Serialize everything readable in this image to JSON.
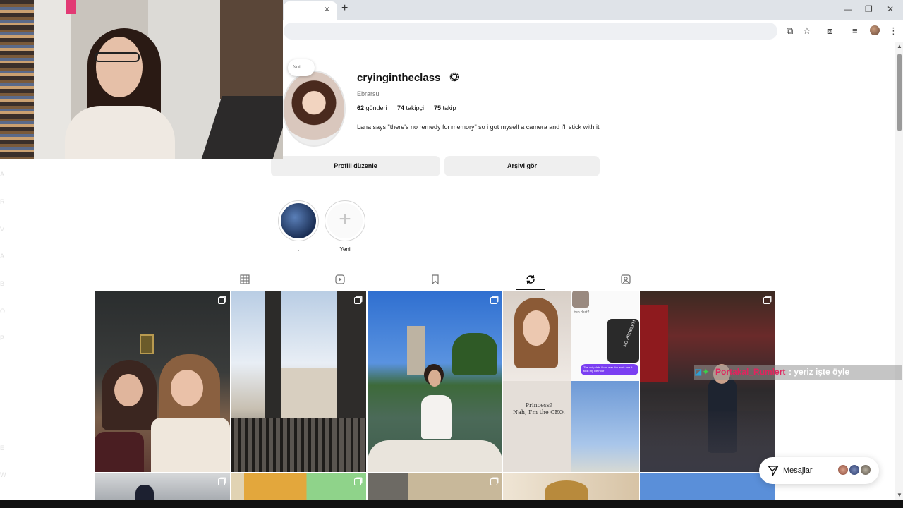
{
  "browser": {
    "tab_close": "×",
    "new_tab": "+",
    "minimize": "—",
    "restore": "❐",
    "close": "✕"
  },
  "profile": {
    "note": "Not...",
    "username": "cryinginthe­class",
    "full_name": "Ebrarsu",
    "stats": {
      "posts_count": "62",
      "posts_label": "gönderi",
      "followers_count": "74",
      "followers_label": "takipçi",
      "following_count": "75",
      "following_label": "takip"
    },
    "bio": "Lana says \"there's no remedy for memory\" so i got myself a camera and i'll stick with it",
    "buttons": {
      "edit_profile": "Profili düzenle",
      "view_archive": "Arşivi gör"
    }
  },
  "highlights": [
    {
      "label": "."
    },
    {
      "label": "Yeni",
      "plus": "+"
    }
  ],
  "tabs": [
    "posts-grid",
    "reels",
    "saved",
    "reposts",
    "tagged"
  ],
  "active_tab": "reposts",
  "grid_thumbnail_text": {
    "chat_small": "fren dest?",
    "chat_purple": "The only date i had was the work one it took my ice hour",
    "shirt": "Princess?\nNah, I'm the CEO.",
    "tag": "NO PROBLEM"
  },
  "chat_overlay": {
    "username": "Portakal_Rumlert",
    "message": ": yeriz işte öyle"
  },
  "messages": {
    "label": "Mesajlar"
  },
  "colors": {
    "accent_chat_name": "#e0245e",
    "button_bg": "#efefef",
    "muted_text": "#737373"
  }
}
